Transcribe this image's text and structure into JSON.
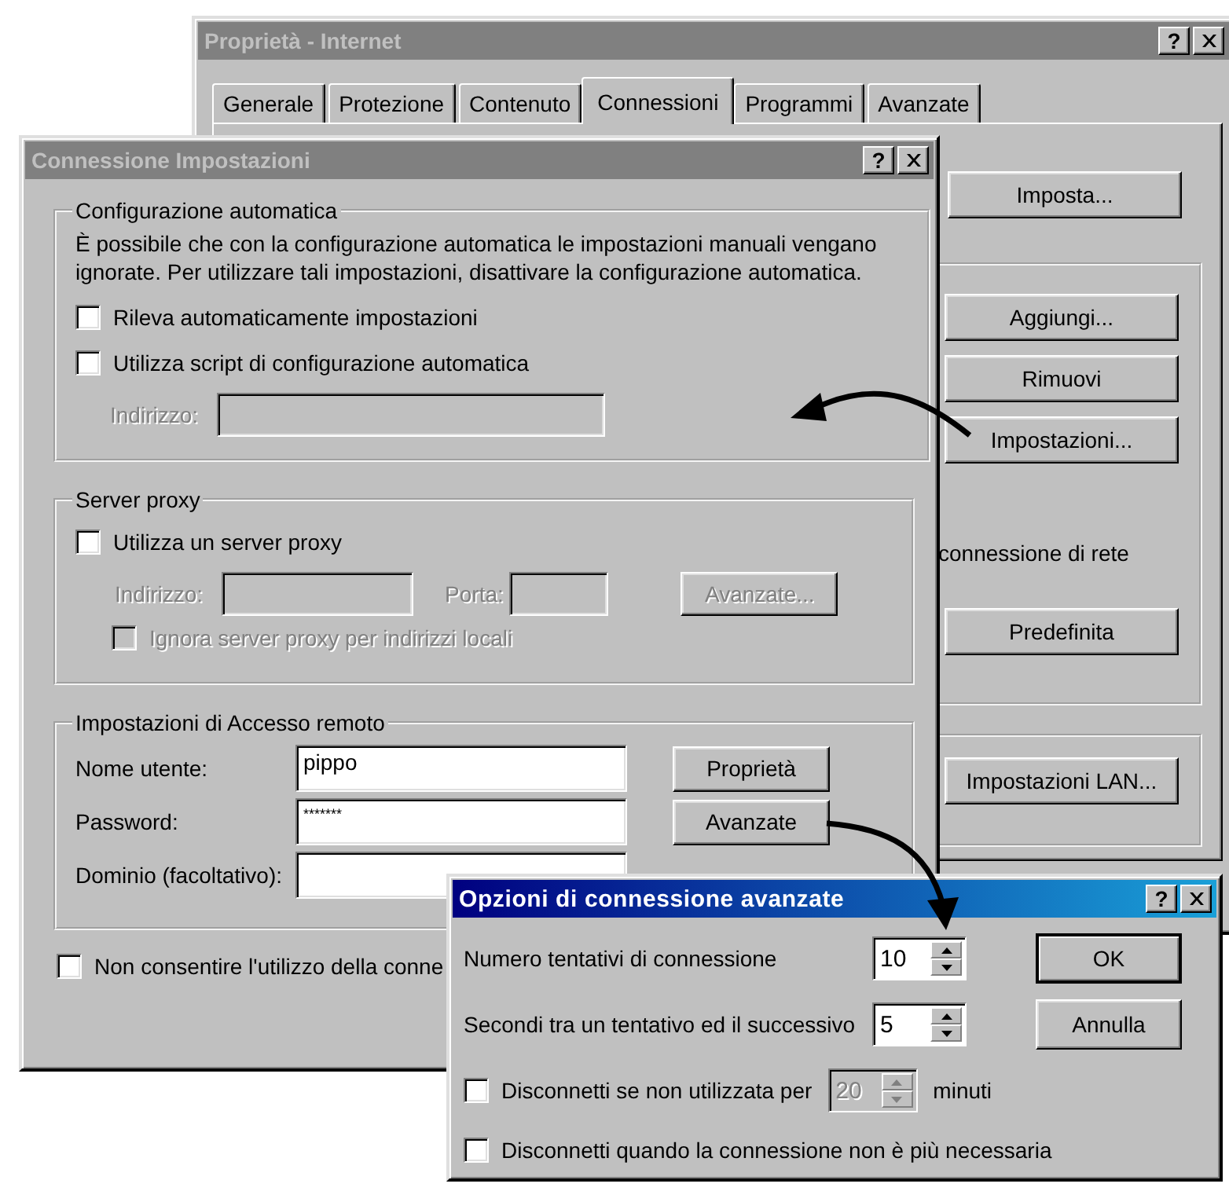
{
  "internet_properties": {
    "title": "Proprietà - Internet",
    "active": false,
    "help": "?",
    "tabs": [
      {
        "label": "Generale",
        "selected": false
      },
      {
        "label": "Protezione",
        "selected": false
      },
      {
        "label": "Contenuto",
        "selected": false
      },
      {
        "label": "Connessioni",
        "selected": true
      },
      {
        "label": "Programmi",
        "selected": false
      },
      {
        "label": "Avanzate",
        "selected": false
      }
    ],
    "setup_button": "Imposta...",
    "dialup_buttons": [
      "Aggiungi...",
      "Rimuovi",
      "Impostazioni..."
    ],
    "network_text": "connessione di rete",
    "default_button": "Predefinita",
    "lan_button": "Impostazioni LAN..."
  },
  "connection_settings": {
    "title": "Connessione Impostazioni",
    "active": false,
    "help": "?",
    "auto_config": {
      "legend": "Configurazione automatica",
      "description": "È possibile che con la configurazione automatica le impostazioni manuali vengano ignorate. Per utilizzare tali impostazioni, disattivare la configurazione automatica.",
      "options": [
        {
          "label": "Rileva automaticamente impostazioni",
          "checked": false
        },
        {
          "label": "Utilizza script di configurazione automatica",
          "checked": false
        }
      ],
      "address_label": "Indirizzo:"
    },
    "proxy": {
      "legend": "Server proxy",
      "use_proxy": {
        "label": "Utilizza un server proxy",
        "checked": false
      },
      "address_label": "Indirizzo:",
      "port_label": "Porta:",
      "advanced_button": "Avanzate...",
      "bypass": {
        "label": "Ignora server proxy per indirizzi locali",
        "checked": false
      }
    },
    "dialup": {
      "legend": "Impostazioni di Accesso remoto",
      "fields": [
        {
          "label": "Nome utente:",
          "value": "pippo"
        },
        {
          "label": "Password:",
          "value": "*******"
        },
        {
          "label": "Dominio (facoltativo):"
        }
      ],
      "buttons": [
        "Proprietà",
        "Avanzate"
      ]
    },
    "no_connection": {
      "label": "Non consentire l'utilizzo della conne",
      "checked": false
    }
  },
  "advanced_options": {
    "title": "Opzioni di connessione avanzate",
    "active": true,
    "help": "?",
    "spinners": [
      {
        "label": "Numero tentativi di connessione",
        "value": "10"
      },
      {
        "label": "Secondi tra un tentativo ed il successivo",
        "value": "5"
      }
    ],
    "idle": {
      "label": "Disconnetti se non utilizzata per",
      "checked": false,
      "value": "20",
      "unit": "minuti"
    },
    "auto_disconnect": {
      "label": "Disconnetti quando la connessione non è più necessaria",
      "checked": false
    },
    "buttons": [
      {
        "label": "OK",
        "default": true
      },
      {
        "label": "Annulla",
        "default": false
      }
    ]
  }
}
